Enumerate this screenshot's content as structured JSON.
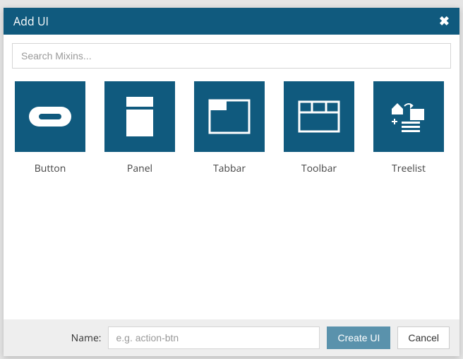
{
  "header": {
    "title": "Add UI"
  },
  "search": {
    "placeholder": "Search Mixins..."
  },
  "tiles": [
    {
      "label": "Button"
    },
    {
      "label": "Panel"
    },
    {
      "label": "Tabbar"
    },
    {
      "label": "Toolbar"
    },
    {
      "label": "Treelist"
    }
  ],
  "footer": {
    "name_label": "Name:",
    "name_placeholder": "e.g. action-btn",
    "create_label": "Create UI",
    "cancel_label": "Cancel"
  }
}
